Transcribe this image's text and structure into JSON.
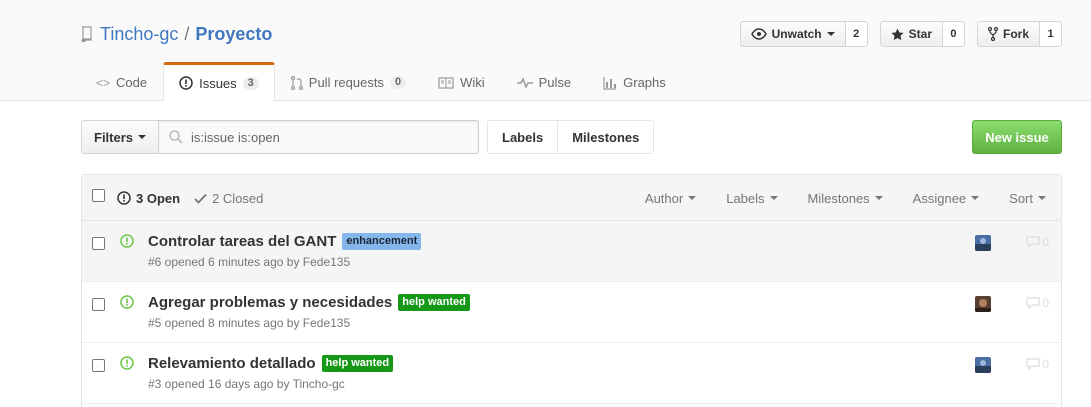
{
  "repo": {
    "owner": "Tincho-gc",
    "separator": "/",
    "name": "Proyecto"
  },
  "actions": {
    "watch_label": "Unwatch",
    "watch_count": "2",
    "star_label": "Star",
    "star_count": "0",
    "fork_label": "Fork",
    "fork_count": "1"
  },
  "nav": {
    "code": "Code",
    "issues": "Issues",
    "issues_count": "3",
    "pulls": "Pull requests",
    "pulls_count": "0",
    "wiki": "Wiki",
    "pulse": "Pulse",
    "graphs": "Graphs"
  },
  "subnav": {
    "filters_label": "Filters",
    "search_value": "is:issue is:open",
    "labels_link": "Labels",
    "milestones_link": "Milestones",
    "new_issue": "New issue"
  },
  "list_header": {
    "open_state": "3 Open",
    "closed_state": "2 Closed",
    "author": "Author",
    "labels": "Labels",
    "milestones": "Milestones",
    "assignee": "Assignee",
    "sort": "Sort"
  },
  "issues": [
    {
      "title": "Controlar tareas del GANT",
      "label": "enhancement",
      "label_bg": "#84b6eb",
      "label_fg": "#1c2733",
      "meta": "#6 opened 6 minutes ago by Fede135",
      "comments": "0"
    },
    {
      "title": "Agregar problemas y necesidades",
      "label": "help wanted",
      "label_bg": "#159818",
      "label_fg": "#ffffff",
      "meta": "#5 opened 8 minutes ago by Fede135",
      "comments": "0"
    },
    {
      "title": "Relevamiento detallado",
      "label": "help wanted",
      "label_bg": "#159818",
      "label_fg": "#ffffff",
      "meta": "#3 opened 16 days ago by Tincho-gc",
      "comments": "0"
    }
  ],
  "colors": {
    "link": "#4078c0",
    "open_icon": "#6cc644",
    "tab_accent": "#d26911",
    "new_issue_green": "#60b044"
  }
}
